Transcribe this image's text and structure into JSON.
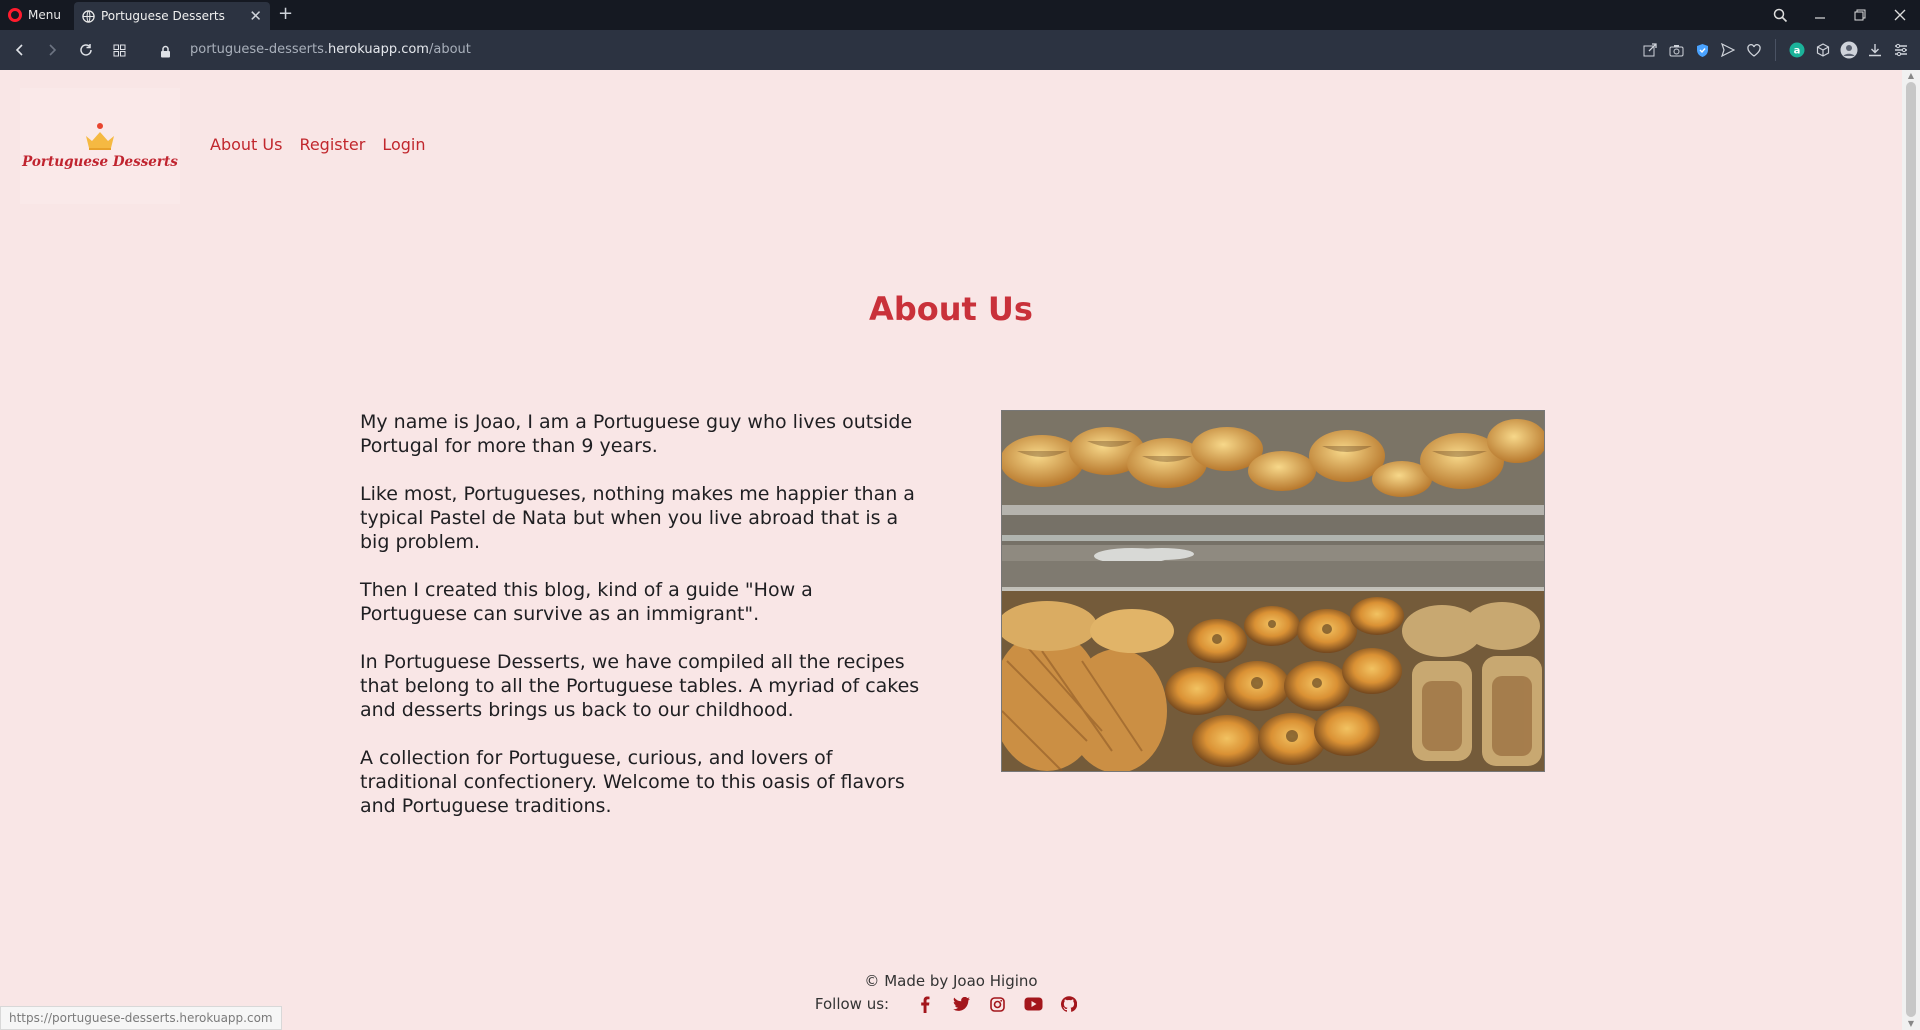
{
  "browser": {
    "menu_label": "Menu",
    "tab_title": "Portuguese Desserts",
    "url_prefix": "portuguese-desserts.",
    "url_domain": "herokuapp.com",
    "url_path": "/about",
    "status_url": "https://portuguese-desserts.herokuapp.com"
  },
  "site": {
    "logo_text": "Portuguese Desserts",
    "nav": [
      {
        "label": "About Us"
      },
      {
        "label": "Register"
      },
      {
        "label": "Login"
      }
    ]
  },
  "main": {
    "title": "About Us",
    "paragraphs": [
      "My name is Joao, I am a Portuguese guy who lives outside Portugal for more than 9 years.",
      "Like most, Portugueses, nothing makes me happier than a typical Pastel de Nata but when you live abroad that is a big problem.",
      "Then I created this blog, kind of a guide \"How a Portuguese can survive as an immigrant\".",
      "In Portuguese Desserts, we have compiled all the recipes that belong to all the Portuguese tables. A myriad of cakes and desserts brings us back to our childhood.",
      "A collection for Portuguese, curious, and lovers of traditional confectionery. Welcome to this oasis of flavors and Portuguese traditions."
    ]
  },
  "footer": {
    "credit": "© Made by Joao Higino",
    "follow_label": "Follow us:",
    "social_icons": [
      "facebook-icon",
      "twitter-icon",
      "instagram-icon",
      "youtube-icon",
      "github-icon"
    ]
  },
  "colors": {
    "page_bg": "#f9e6e6",
    "accent": "#c1272d",
    "chrome_dark": "#151922",
    "chrome_bar": "#2c3341"
  }
}
